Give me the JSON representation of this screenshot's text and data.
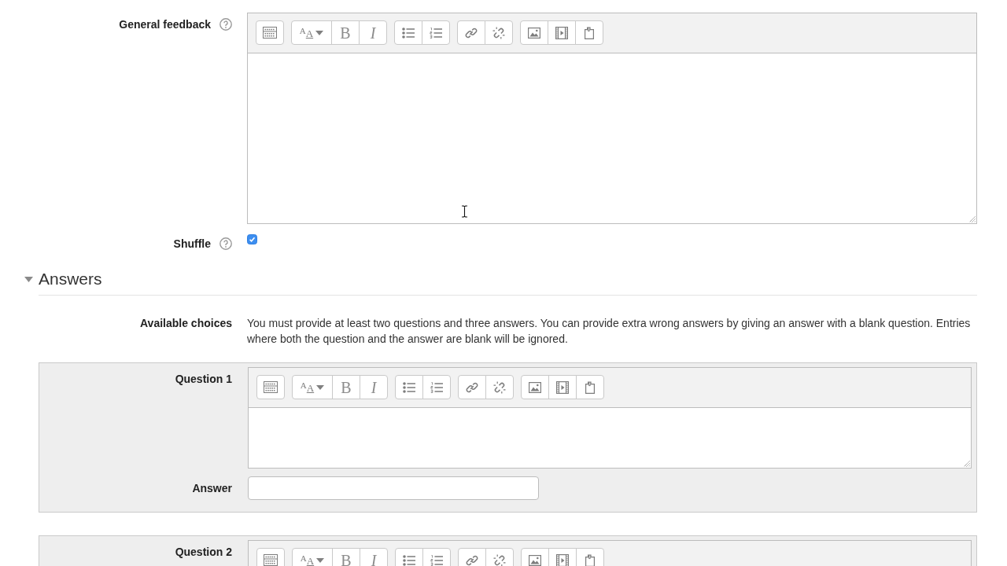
{
  "fields": [
    {
      "kind": "editor",
      "label": "General feedback",
      "help": true,
      "editor": {
        "toolbar": [
          [
            {
              "kind": "toggle"
            }
          ],
          [
            {
              "kind": "style",
              "label": "$^{A}$A"
            },
            {
              "kind": "bold",
              "label": "B"
            },
            {
              "kind": "italic",
              "label": "I"
            }
          ],
          [
            {
              "kind": "bullets"
            },
            {
              "kind": "numbers"
            }
          ],
          [
            {
              "kind": "link"
            },
            {
              "kind": "unlink"
            }
          ],
          [
            {
              "kind": "image"
            },
            {
              "kind": "media"
            },
            {
              "kind": "files"
            }
          ]
        ],
        "text_area": {
          "resize_grip": true
        }
      }
    },
    {
      "kind": "checkbox",
      "label": "Shuffle",
      "help": true,
      "checked": true
    }
  ],
  "answers": {
    "heading": "Answers",
    "expanded": true,
    "intro": {
      "label": "Available choices",
      "text": "You must provide at least two questions and three answers. You can provide extra wrong answers by giving an answer with a blank question. Entries where both the question and the answer are blank will be ignored."
    },
    "questions": [
      {
        "label": "Question 1",
        "editor": {
          "toolbar": [
            [
              {
                "kind": "toggle"
              }
            ],
            [
              {
                "kind": "style",
                "label": "$^{A}$A"
              },
              {
                "kind": "bold",
                "label": "B"
              },
              {
                "kind": "italic",
                "label": "I"
              }
            ],
            [
              {
                "kind": "bullets"
              },
              {
                "kind": "numbers"
              }
            ],
            [
              {
                "kind": "link"
              },
              {
                "kind": "unlink"
              }
            ],
            [
              {
                "kind": "image"
              },
              {
                "kind": "media"
              },
              {
                "kind": "files"
              }
            ]
          ],
          "text_area": {
            "resize_grip": true
          }
        },
        "answer": {
          "label": "Answer"
        }
      },
      {
        "label": "Question 2",
        "editor": {
          "toolbar": [
            [
              {
                "kind": "toggle"
              }
            ],
            [
              {
                "kind": "style",
                "label": "$^{A}$A"
              },
              {
                "kind": "bold",
                "label": "B"
              },
              {
                "kind": "italic",
                "label": "I"
              }
            ],
            [
              {
                "kind": "bullets"
              },
              {
                "kind": "numbers"
              }
            ],
            [
              {
                "kind": "link"
              },
              {
                "kind": "unlink"
              }
            ],
            [
              {
                "kind": "image"
              },
              {
                "kind": "media"
              },
              {
                "kind": "files"
              }
            ]
          ]
        }
      }
    ]
  },
  "pointer": {
    "kind": "text"
  }
}
